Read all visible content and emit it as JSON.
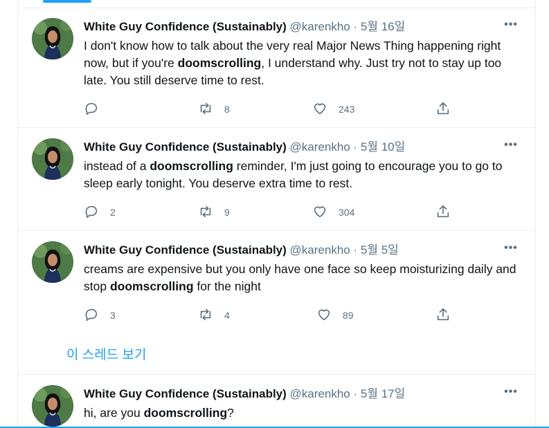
{
  "tweets": [
    {
      "name": "White Guy Confidence (Sustainably)",
      "handle": "@karenkho",
      "dot": "·",
      "date": "5월 16일",
      "more": "•••",
      "text_parts": [
        {
          "t": "I don't know how to talk about the very real Major News Thing happening right now, but if you're ",
          "b": false
        },
        {
          "t": "doomscrolling",
          "b": true
        },
        {
          "t": ", I understand why. Just try not to stay up too late. You still deserve time to rest.",
          "b": false
        }
      ],
      "reply": "",
      "retweet": "8",
      "like": "243"
    },
    {
      "name": "White Guy Confidence (Sustainably)",
      "handle": "@karenkho",
      "dot": "·",
      "date": "5월 10일",
      "more": "•••",
      "text_parts": [
        {
          "t": "instead of a ",
          "b": false
        },
        {
          "t": "doomscrolling",
          "b": true
        },
        {
          "t": " reminder, I'm just going to encourage you to go to sleep early tonight. You deserve extra time to rest.",
          "b": false
        }
      ],
      "reply": "2",
      "retweet": "9",
      "like": "304"
    },
    {
      "name": "White Guy Confidence (Sustainably)",
      "handle": "@karenkho",
      "dot": "·",
      "date": "5월 5일",
      "more": "•••",
      "text_parts": [
        {
          "t": "creams are expensive but you only have one face so keep moisturizing daily and stop ",
          "b": false
        },
        {
          "t": "doomscrolling",
          "b": true
        },
        {
          "t": " for the night",
          "b": false
        }
      ],
      "reply": "3",
      "retweet": "4",
      "like": "89"
    },
    {
      "name": "White Guy Confidence (Sustainably)",
      "handle": "@karenkho",
      "dot": "·",
      "date": "5월 17일",
      "more": "•••",
      "text_parts": [
        {
          "t": "hi, are you ",
          "b": false
        },
        {
          "t": "doomscrolling",
          "b": true
        },
        {
          "t": "?",
          "b": false
        }
      ],
      "reply": "",
      "retweet": "",
      "like": ""
    }
  ],
  "thread_link": "이 스레드 보기",
  "icons": {
    "reply": "reply-icon",
    "retweet": "retweet-icon",
    "like": "heart-icon",
    "share": "share-icon",
    "more": "more-icon"
  },
  "colors": {
    "accent": "#1da1f2",
    "secondary_text": "#5b7083",
    "primary_text": "#0f1419",
    "divider": "#ebeef0"
  }
}
